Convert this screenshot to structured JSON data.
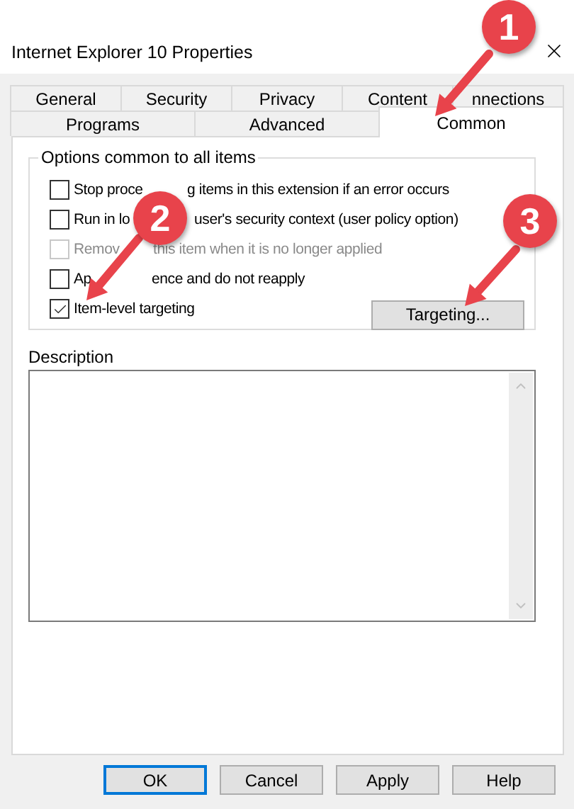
{
  "window": {
    "title": "Internet Explorer 10 Properties"
  },
  "tab_rows": [
    {
      "tabs": [
        {
          "label": "General",
          "selected": false
        },
        {
          "label": "Security",
          "selected": false
        },
        {
          "label": "Privacy",
          "selected": false
        },
        {
          "label": "Content",
          "selected": false
        },
        {
          "label": "nnections",
          "selected": false
        }
      ]
    },
    {
      "tabs": [
        {
          "label": "Programs",
          "selected": false
        },
        {
          "label": "Advanced",
          "selected": false
        },
        {
          "label": "Common",
          "selected": true
        }
      ]
    }
  ],
  "options_group": {
    "title": "Options common to all items",
    "options": [
      {
        "label_parts": [
          "Stop proce",
          "g items in this extension if an error occurs"
        ],
        "checked": false,
        "disabled": false
      },
      {
        "label_parts": [
          "Run in lo",
          "user's security context (user policy option)"
        ],
        "checked": false,
        "disabled": false
      },
      {
        "label_parts": [
          "Remov",
          "this item when it is no longer applied"
        ],
        "checked": false,
        "disabled": true
      },
      {
        "label_parts": [
          "Ap",
          "ence and do not reapply"
        ],
        "checked": false,
        "disabled": false
      },
      {
        "label_parts": [
          "Item-level targeting"
        ],
        "checked": true,
        "disabled": false
      }
    ],
    "button": "Targeting..."
  },
  "description": {
    "label": "Description"
  },
  "buttons": [
    {
      "label": "OK",
      "default": true
    },
    {
      "label": "Cancel",
      "default": false
    },
    {
      "label": "Apply",
      "default": false
    },
    {
      "label": "Help",
      "default": false
    }
  ],
  "callouts": [
    {
      "number": "1"
    },
    {
      "number": "2"
    },
    {
      "number": "3"
    }
  ]
}
